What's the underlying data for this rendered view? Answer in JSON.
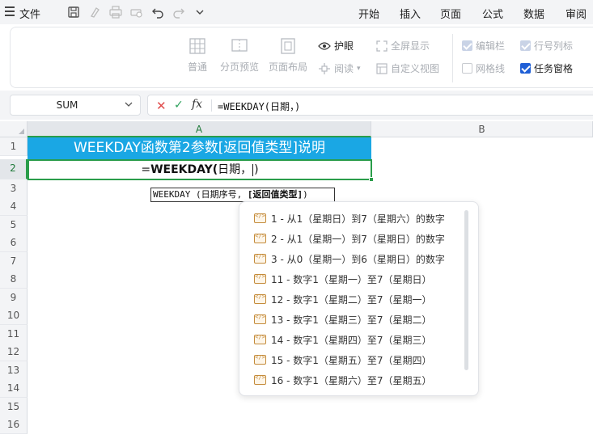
{
  "menubar": {
    "file_label": "文件",
    "tabs": [
      "开始",
      "插入",
      "页面",
      "公式",
      "数据",
      "审阅"
    ]
  },
  "ribbon": {
    "normal": "普通",
    "page_break_preview": "分页预览",
    "page_layout": "页面布局",
    "eye_protection": "护眼",
    "reading": "阅读",
    "full_screen": "全屏显示",
    "custom_view": "自定义视图",
    "edit_bar": "编辑栏",
    "row_col_headers": "行号列标",
    "gridlines": "网格线",
    "task_pane": "任务窗格"
  },
  "formula_bar": {
    "name_box": "SUM",
    "formula": "=WEEKDAY(日期，)"
  },
  "grid": {
    "columns": [
      "A",
      "B"
    ],
    "rows": [
      "1",
      "2",
      "3",
      "4",
      "5",
      "6",
      "7",
      "8",
      "9",
      "10",
      "11",
      "12",
      "13",
      "14",
      "15",
      "16"
    ],
    "title_cell": "WEEKDAY函数第2参数[返回值类型]说明",
    "active_cell": {
      "prefix": "=",
      "func": "WEEKDAY(",
      "args": "日期，",
      "suffix": ")"
    }
  },
  "tooltip": {
    "prefix": "WEEKDAY (日期序号, ",
    "current_arg": "[返回值类型]",
    "suffix": ")"
  },
  "autocomplete": {
    "items": [
      "1 - 从1（星期日）到7（星期六）的数字",
      "2 - 从1（星期一）到7（星期日）的数字",
      "3 - 从0（星期一）到6（星期日）的数字",
      "11 - 数字1（星期一）至7（星期日）",
      "12 - 数字1（星期二）至7（星期一）",
      "13 - 数字1（星期三）至7（星期二）",
      "14 - 数字1（星期四）至7（星期三）",
      "15 - 数字1（星期五）至7（星期四）",
      "16 - 数字1（星期六）至7（星期五）"
    ]
  },
  "colors": {
    "title_fill": "#1aa7e4",
    "selection_green": "#2a9d4a",
    "checkbox_blue": "#1f5fd6"
  }
}
